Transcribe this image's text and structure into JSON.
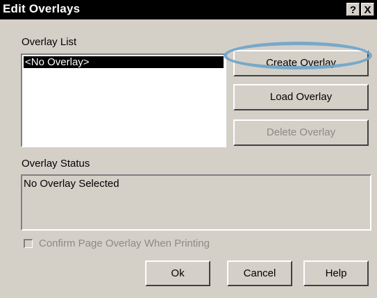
{
  "window": {
    "title": "Edit Overlays",
    "help_glyph": "?",
    "close_glyph": "X"
  },
  "overlay_list": {
    "label": "Overlay List",
    "items": [
      "<No Overlay>"
    ],
    "selected_index": 0
  },
  "buttons": {
    "create": "Create Overlay",
    "load": "Load Overlay",
    "delete": "Delete Overlay",
    "ok": "Ok",
    "cancel": "Cancel",
    "help": "Help"
  },
  "overlay_status": {
    "label": "Overlay Status",
    "value": "No Overlay Selected"
  },
  "confirm_checkbox": {
    "label": "Confirm Page Overlay When Printing",
    "checked": false,
    "enabled": false
  },
  "colors": {
    "dialog_bg": "#d4d0c8",
    "titlebar_bg": "#000000",
    "highlight": "#6ea3c8",
    "disabled_text": "#8c8a86"
  }
}
